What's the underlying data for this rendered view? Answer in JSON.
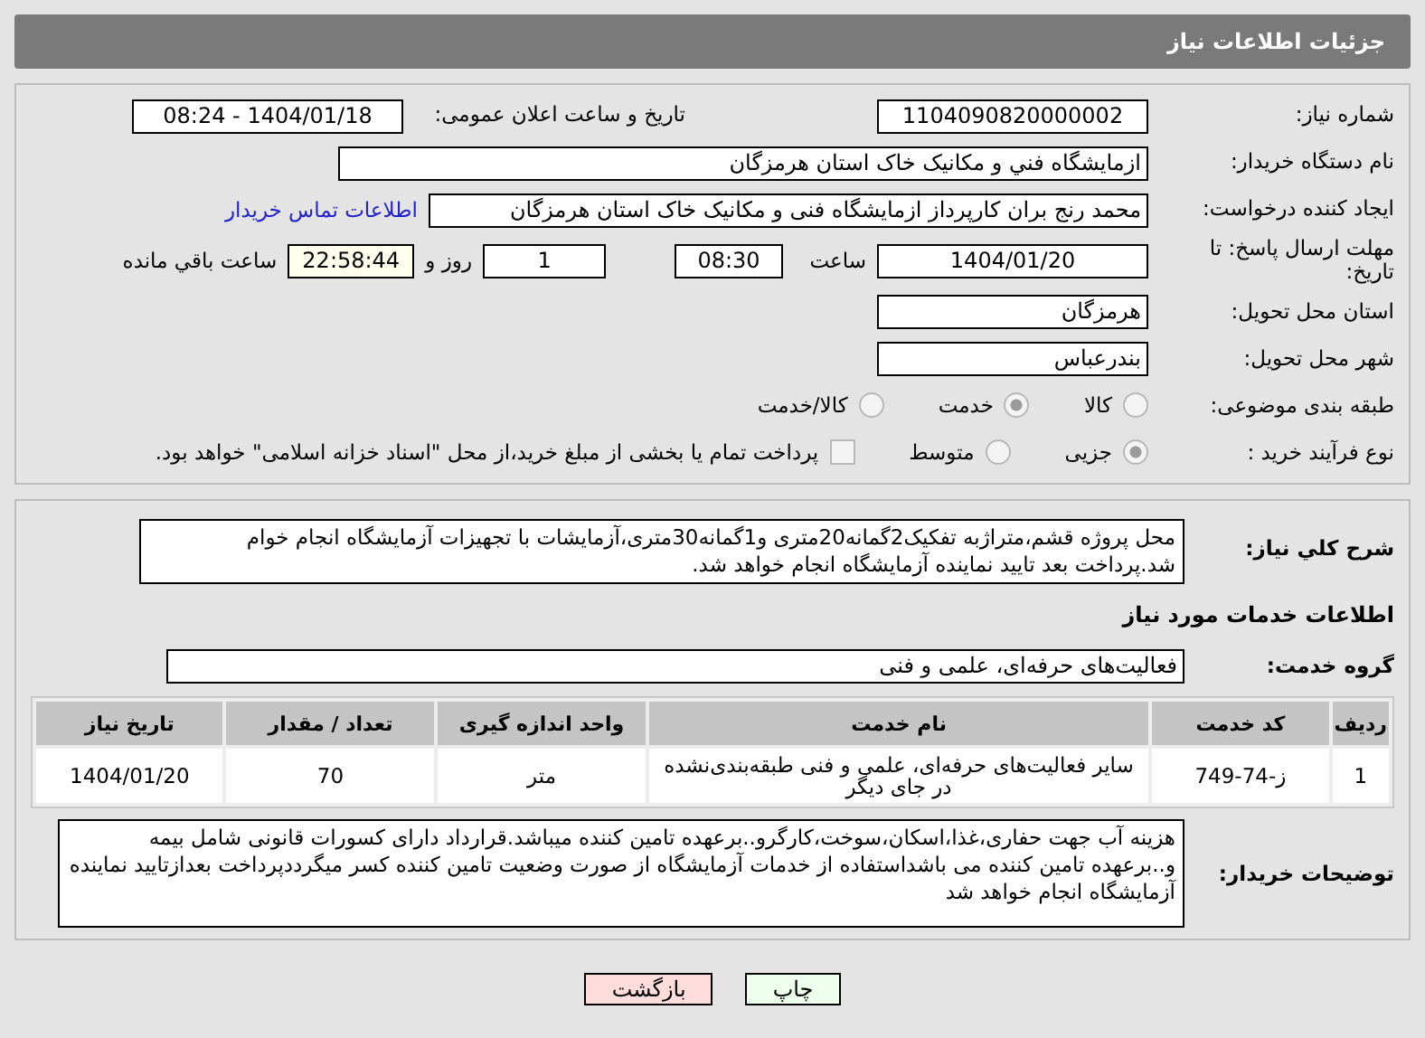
{
  "header": {
    "title": "جزئیات اطلاعات نیاز"
  },
  "need_number": {
    "label": "شماره نیاز:",
    "value": "1104090820000002"
  },
  "announce": {
    "label": "تاریخ و ساعت اعلان عمومی:",
    "value": "1404/01/18 - 08:24"
  },
  "buyer_org": {
    "label": "نام دستگاه خریدار:",
    "value": "ازمایشگاه فني و مکانيک خاک استان هرمزگان"
  },
  "requester": {
    "label": "ایجاد کننده درخواست:",
    "value": "محمد رنج بران کارپرداز ازمایشگاه فنی و مکانیک خاک استان هرمزگان",
    "link": "اطلاعات تماس خریدار"
  },
  "deadline": {
    "label": "مهلت ارسال پاسخ: تا تاریخ:",
    "date": "1404/01/20",
    "time_label": "ساعت",
    "time": "08:30",
    "days": "1",
    "days_label": "روز و",
    "remaining": "22:58:44",
    "remaining_label": "ساعت باقي مانده"
  },
  "province": {
    "label": "استان محل تحویل:",
    "value": "هرمزگان"
  },
  "city": {
    "label": "شهر محل تحویل:",
    "value": "بندرعباس"
  },
  "category": {
    "label": "طبقه بندی موضوعی:",
    "options": [
      {
        "label": "کالا",
        "selected": false
      },
      {
        "label": "خدمت",
        "selected": true
      },
      {
        "label": "کالا/خدمت",
        "selected": false
      }
    ]
  },
  "process": {
    "label": "نوع فرآیند خرید :",
    "options": [
      {
        "label": "جزیی",
        "selected": true
      },
      {
        "label": "متوسط",
        "selected": false
      }
    ],
    "treasury": {
      "label": "پرداخت تمام یا بخشی از مبلغ خرید،از محل \"اسناد خزانه اسلامی\" خواهد بود.",
      "checked": false
    }
  },
  "description": {
    "label": "شرح کلي نیاز:",
    "value": "محل پروژه قشم،متراژبه تفکیک2گمانه20متری و1گمانه30متری،آزمایشات با تجهیزات آزمایشگاه انجام خوام شد.پرداخت بعد تایید نماینده آزمایشگاه انجام خواهد شد."
  },
  "services_title": "اطلاعات خدمات مورد نیاز",
  "service_group": {
    "label": "گروه خدمت:",
    "value": "فعالیت‌های حرفه‌ای، علمی و فنی"
  },
  "table": {
    "columns": [
      "ردیف",
      "کد خدمت",
      "نام خدمت",
      "واحد اندازه گیری",
      "تعداد / مقدار",
      "تاریخ نیاز"
    ],
    "rows": [
      [
        "1",
        "ز-74-749",
        "سایر فعالیت‌های حرفه‌ای، علمی و فنی طبقه‌بندی‌نشده در جای دیگر",
        "متر",
        "70",
        "1404/01/20"
      ]
    ]
  },
  "buyer_notes": {
    "label": "توضیحات خریدار:",
    "value": "هزینه آب جهت حفاری،غذا،اسکان،سوخت،کارگرو..برعهده تامین کننده میباشد.قرارداد دارای کسورات قانونی شامل بیمه و..برعهده تامین کننده می باشداستفاده از خدمات آزمایشگاه از صورت وضعیت تامین کننده کسر میگرددپرداخت بعدازتایید نماینده آزمایشگاه انجام خواهد شد"
  },
  "buttons": [
    {
      "label": "چاپ",
      "kind": "print"
    },
    {
      "label": "بازگشت",
      "kind": "back"
    }
  ]
}
